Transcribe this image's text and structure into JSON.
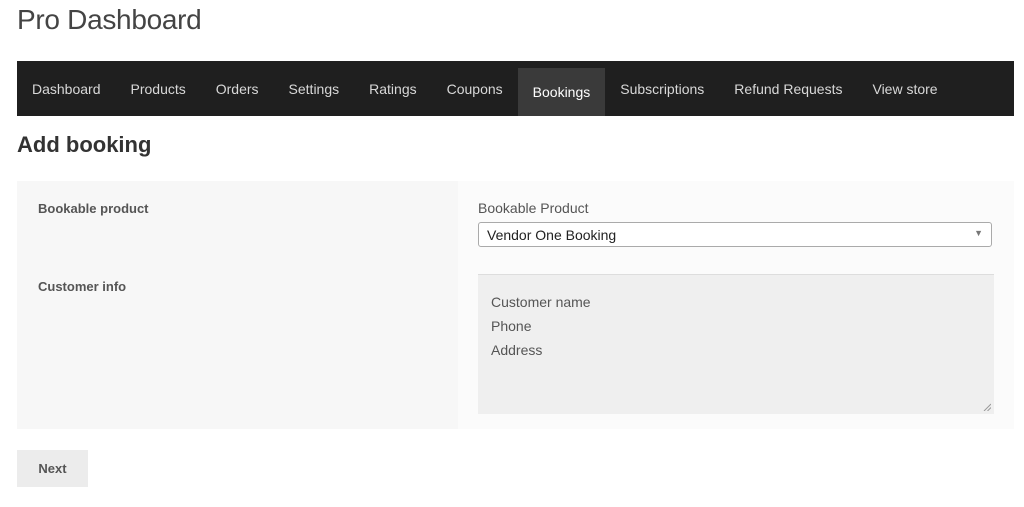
{
  "site": {
    "title": "Pro Dashboard"
  },
  "nav": {
    "items": [
      {
        "label": "Dashboard"
      },
      {
        "label": "Products"
      },
      {
        "label": "Orders"
      },
      {
        "label": "Settings"
      },
      {
        "label": "Ratings"
      },
      {
        "label": "Coupons"
      },
      {
        "label": "Bookings",
        "active": true
      },
      {
        "label": "Subscriptions"
      },
      {
        "label": "Refund Requests"
      },
      {
        "label": "View store"
      }
    ]
  },
  "page": {
    "heading": "Add booking"
  },
  "form": {
    "bookable_label": "Bookable product",
    "customer_label": "Customer info",
    "select": {
      "caption": "Bookable Product",
      "value": "Vendor One Booking",
      "arrow_icon": "triangle-down-icon"
    },
    "customer_info": {
      "lines": [
        "Customer name",
        "Phone",
        "Address"
      ]
    },
    "next_label": "Next"
  },
  "colors": {
    "nav_bg": "#1f1f1f",
    "nav_active_bg": "#3a3a3a",
    "panel_left": "#f7f7f7",
    "textarea_bg": "#efefef"
  }
}
